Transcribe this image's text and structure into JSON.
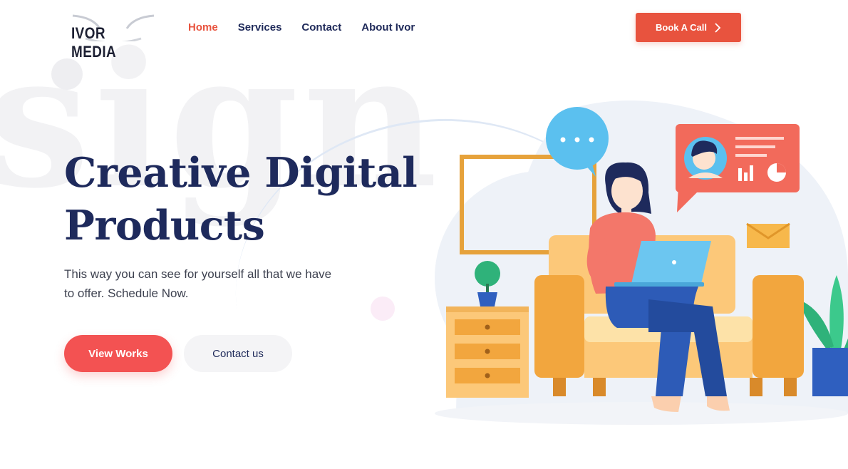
{
  "brand": {
    "logo_text": "IVOR MEDIA"
  },
  "background": {
    "word": "sign"
  },
  "nav": {
    "items": [
      {
        "label": "Home",
        "active": true
      },
      {
        "label": "Services",
        "active": false
      },
      {
        "label": "Contact",
        "active": false
      },
      {
        "label": "About Ivor",
        "active": false
      }
    ]
  },
  "header": {
    "cta_label": "Book A Call",
    "cta_icon": "chevron-right-icon"
  },
  "hero": {
    "title_line1": "Creative Digital",
    "title_line2": "Products",
    "description": "This way you can see for yourself all that we have to offer. Schedule Now.",
    "primary_button": "View Works",
    "secondary_button": "Contact us"
  },
  "illustration": {
    "description_icon": "woman-with-laptop-on-sofa-illustration"
  },
  "colors": {
    "accent": "#e8533e",
    "primary_button": "#f35252",
    "navy": "#1e2a5c",
    "text": "#3e4250"
  }
}
